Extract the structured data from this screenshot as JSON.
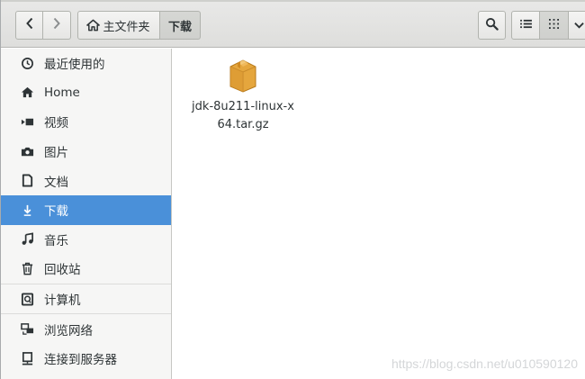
{
  "toolbar": {
    "back_icon": "chevron-left-icon",
    "forward_icon": "chevron-right-icon",
    "search_icon": "search-icon",
    "list_view_icon": "list-view-icon",
    "grid_view_icon": "grid-view-icon",
    "menu_icon": "chevron-down-icon"
  },
  "breadcrumb": {
    "home_label": "主文件夹",
    "current_label": "下载"
  },
  "sidebar": {
    "items": [
      {
        "label": "最近使用的",
        "icon": "clock-icon"
      },
      {
        "label": "Home",
        "icon": "home-icon"
      },
      {
        "label": "视频",
        "icon": "video-icon"
      },
      {
        "label": "图片",
        "icon": "camera-icon"
      },
      {
        "label": "文档",
        "icon": "document-icon"
      },
      {
        "label": "下载",
        "icon": "download-icon",
        "active": true
      },
      {
        "label": "音乐",
        "icon": "music-icon"
      },
      {
        "label": "回收站",
        "icon": "trash-icon"
      },
      {
        "label": "计算机",
        "icon": "computer-icon"
      },
      {
        "label": "浏览网络",
        "icon": "network-icon"
      },
      {
        "label": "连接到服务器",
        "icon": "server-icon"
      }
    ]
  },
  "files": [
    {
      "name": "jdk-8u211-linux-x64.tar.gz",
      "icon": "archive-package-icon"
    }
  ],
  "watermark": "https://blog.csdn.net/u010590120",
  "colors": {
    "accent": "#4a90d9",
    "package": "#e5a63d"
  }
}
